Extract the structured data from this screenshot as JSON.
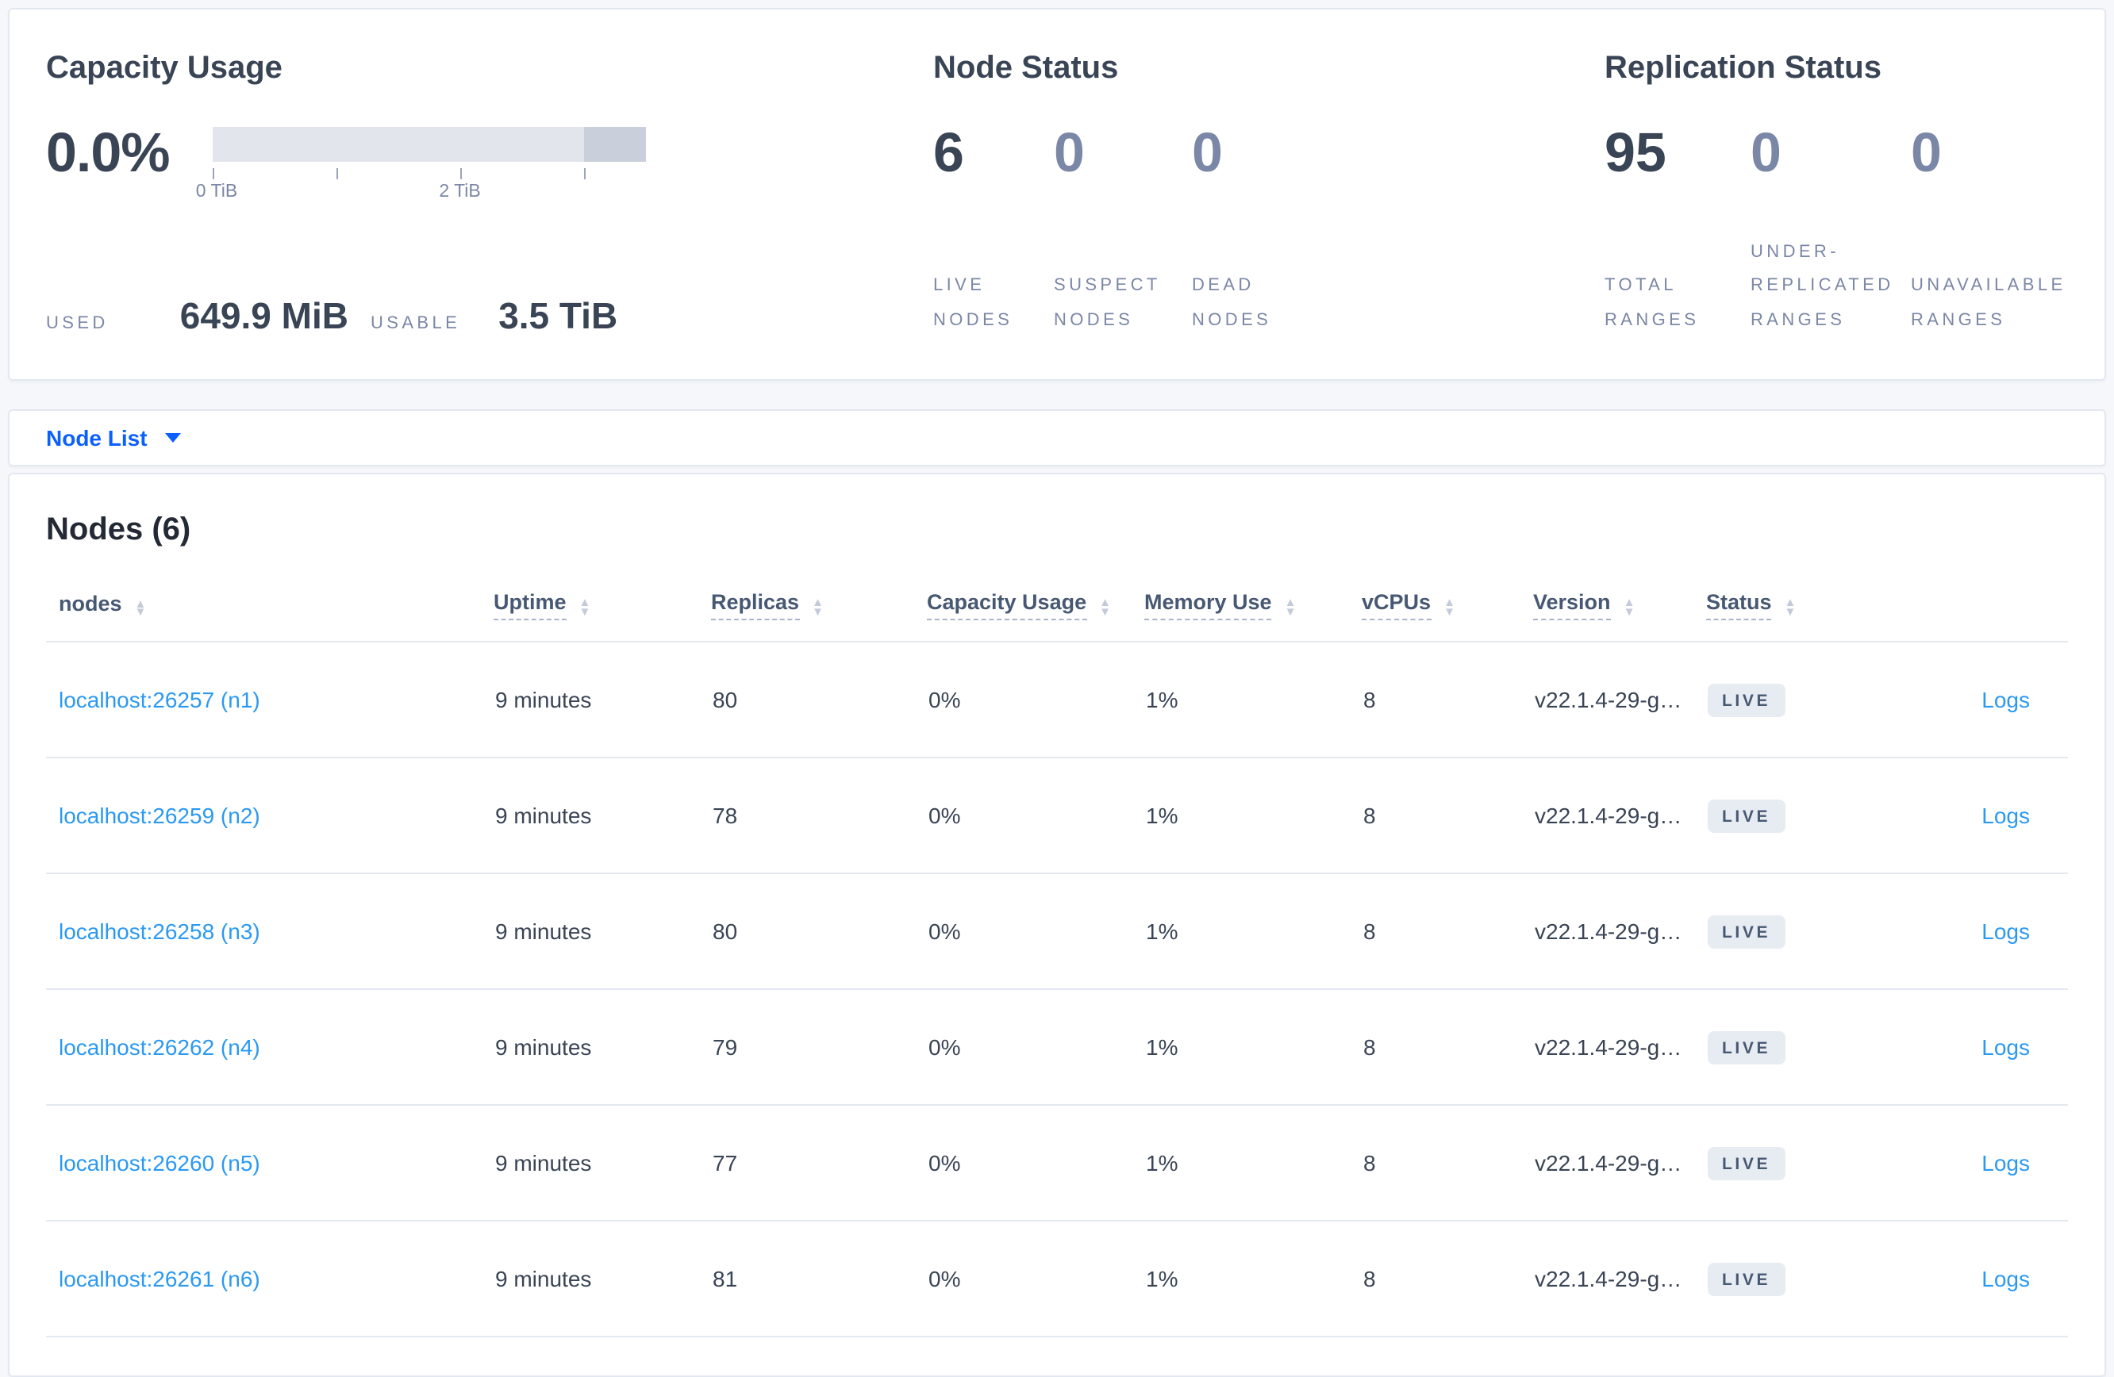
{
  "colors": {
    "page_bg": "#f5f7fa",
    "accent_blue": "#0b5fff",
    "link_blue": "#2b99f2",
    "text_dark": "#394455",
    "text_muted": "#7b87a6",
    "badge_bg": "#e7ecf3",
    "badge_text": "#475872",
    "bar_light": "#e2e5ec",
    "bar_dark": "#c9cfdb"
  },
  "summary": {
    "capacity": {
      "title": "Capacity Usage",
      "percent": "0.0%",
      "tick_labels": [
        "0 TiB",
        "2 TiB"
      ],
      "used_label": "USED",
      "used_value": "649.9 MiB",
      "usable_label": "USABLE",
      "usable_value": "3.5 TiB",
      "bar": {
        "range_tib": [
          0,
          3.5
        ],
        "tick_positions_tib": [
          0,
          1,
          2,
          3
        ],
        "dark_segment_tib": [
          3,
          3.5
        ]
      }
    },
    "node_status": {
      "title": "Node Status",
      "stats": [
        {
          "value": "6",
          "label": "LIVE NODES"
        },
        {
          "value": "0",
          "label": "SUSPECT NODES"
        },
        {
          "value": "0",
          "label": "DEAD NODES"
        }
      ]
    },
    "replication": {
      "title": "Replication Status",
      "stats": [
        {
          "value": "95",
          "label": "TOTAL RANGES"
        },
        {
          "value": "0",
          "label": "UNDER-REPLICATED RANGES"
        },
        {
          "value": "0",
          "label": "UNAVAILABLE RANGES"
        }
      ]
    }
  },
  "view_selector": {
    "label": "Node List"
  },
  "nodes_section": {
    "title": "Nodes (6)",
    "columns": [
      {
        "label": "nodes"
      },
      {
        "label": "Uptime"
      },
      {
        "label": "Replicas"
      },
      {
        "label": "Capacity Usage"
      },
      {
        "label": "Memory Use"
      },
      {
        "label": "vCPUs"
      },
      {
        "label": "Version"
      },
      {
        "label": "Status"
      },
      {
        "label": ""
      }
    ],
    "rows": [
      {
        "address": "localhost:26257 (n1)",
        "uptime": "9 minutes",
        "replicas": "80",
        "capacity": "0%",
        "memory": "1%",
        "vcpus": "8",
        "version": "v22.1.4-29-g…",
        "status": "LIVE",
        "logs": "Logs"
      },
      {
        "address": "localhost:26259 (n2)",
        "uptime": "9 minutes",
        "replicas": "78",
        "capacity": "0%",
        "memory": "1%",
        "vcpus": "8",
        "version": "v22.1.4-29-g…",
        "status": "LIVE",
        "logs": "Logs"
      },
      {
        "address": "localhost:26258 (n3)",
        "uptime": "9 minutes",
        "replicas": "80",
        "capacity": "0%",
        "memory": "1%",
        "vcpus": "8",
        "version": "v22.1.4-29-g…",
        "status": "LIVE",
        "logs": "Logs"
      },
      {
        "address": "localhost:26262 (n4)",
        "uptime": "9 minutes",
        "replicas": "79",
        "capacity": "0%",
        "memory": "1%",
        "vcpus": "8",
        "version": "v22.1.4-29-g…",
        "status": "LIVE",
        "logs": "Logs"
      },
      {
        "address": "localhost:26260 (n5)",
        "uptime": "9 minutes",
        "replicas": "77",
        "capacity": "0%",
        "memory": "1%",
        "vcpus": "8",
        "version": "v22.1.4-29-g…",
        "status": "LIVE",
        "logs": "Logs"
      },
      {
        "address": "localhost:26261 (n6)",
        "uptime": "9 minutes",
        "replicas": "81",
        "capacity": "0%",
        "memory": "1%",
        "vcpus": "8",
        "version": "v22.1.4-29-g…",
        "status": "LIVE",
        "logs": "Logs"
      }
    ]
  }
}
